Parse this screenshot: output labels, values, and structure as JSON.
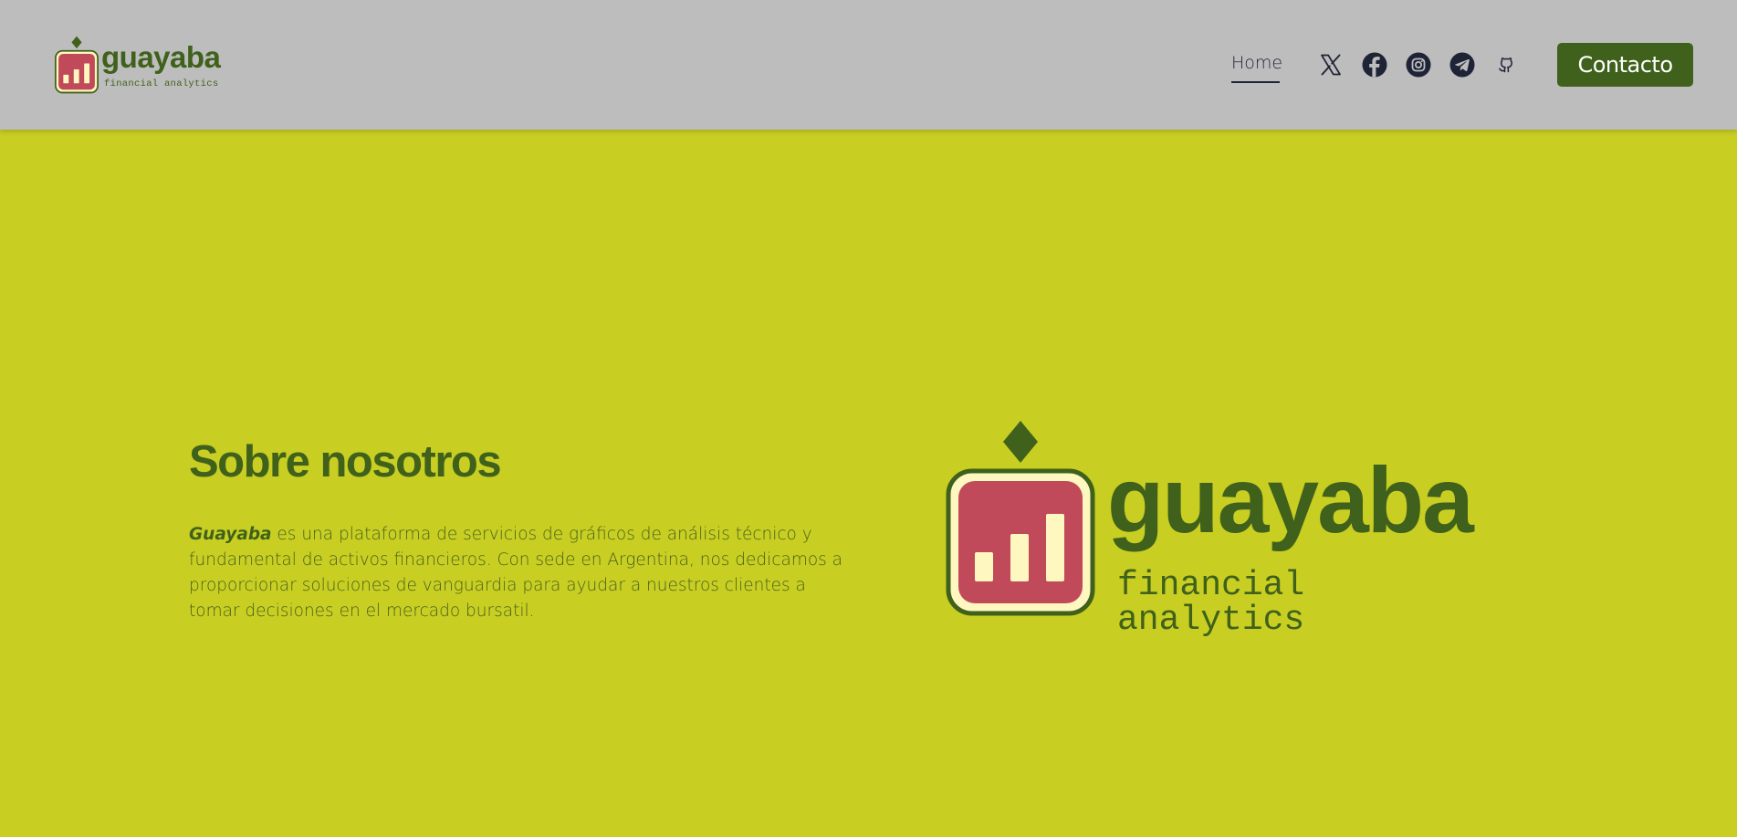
{
  "brand": {
    "name": "guayaba",
    "tagline": "financial analytics"
  },
  "nav": {
    "home": "Home"
  },
  "social": [
    {
      "name": "x",
      "icon": "x-icon"
    },
    {
      "name": "facebook",
      "icon": "facebook-icon"
    },
    {
      "name": "instagram",
      "icon": "instagram-icon"
    },
    {
      "name": "telegram",
      "icon": "telegram-icon"
    },
    {
      "name": "github",
      "icon": "github-icon"
    }
  ],
  "contact_button": "Contacto",
  "about": {
    "title": "Sobre nosotros",
    "company": "Guayaba",
    "body": " es una plataforma de servicios de gráficos de análisis técnico y fundamental de activos financieros. Con sede en Argentina, nos dedicamos a proporcionar soluciones de vanguardia para ayudar a nuestros clientes a tomar decisiones en el mercado bursatil."
  },
  "colors": {
    "page_background": "#c8ce22",
    "header_background": "#bdbdbd",
    "brand_green": "#3f611b",
    "logo_red": "#c04a5a",
    "logo_cream": "#fff7c0",
    "icon_dark": "#1f2336"
  }
}
